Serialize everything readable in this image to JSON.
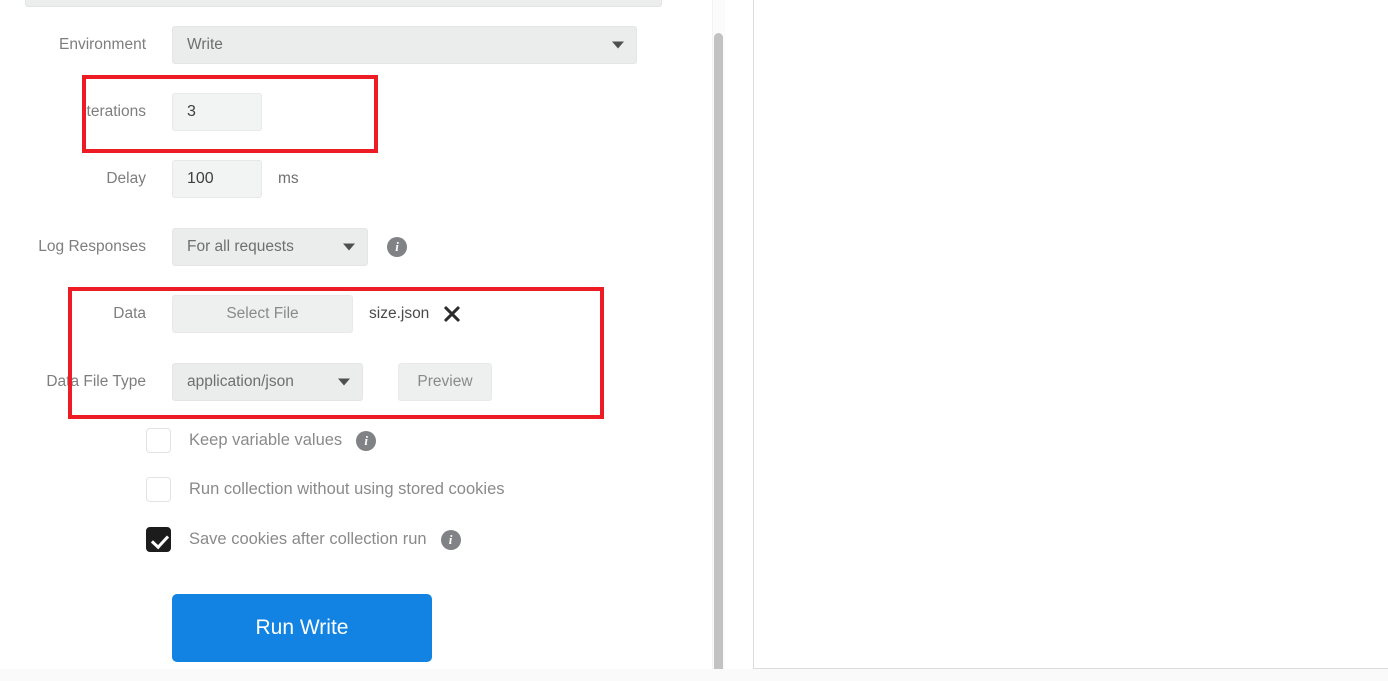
{
  "runner": {
    "environment": {
      "label": "Environment",
      "value": "Write",
      "icon": "chevron-down-icon"
    },
    "iterations": {
      "label": "Iterations",
      "value": "3"
    },
    "delay": {
      "label": "Delay",
      "value": "100",
      "unit": "ms"
    },
    "log_responses": {
      "label": "Log Responses",
      "value": "For all requests",
      "info": "i"
    },
    "data": {
      "label": "Data",
      "select_file_button": "Select File",
      "file_name": "size.json",
      "clear_icon": "close-icon"
    },
    "data_file_type": {
      "label": "Data File Type",
      "value": "application/json",
      "preview_button": "Preview"
    },
    "options": [
      {
        "label": "Keep variable values",
        "checked": false,
        "has_info": true
      },
      {
        "label": "Run collection without using stored cookies",
        "checked": false,
        "has_info": false
      },
      {
        "label": "Save cookies after collection run",
        "checked": true,
        "has_info": true
      }
    ],
    "run_button": {
      "label": "Run Write",
      "color": "#1283e2"
    }
  },
  "annotations": {
    "highlight_color": "#ed1c24",
    "boxes": [
      {
        "name": "iterations-highlight"
      },
      {
        "name": "data-section-highlight"
      }
    ]
  }
}
